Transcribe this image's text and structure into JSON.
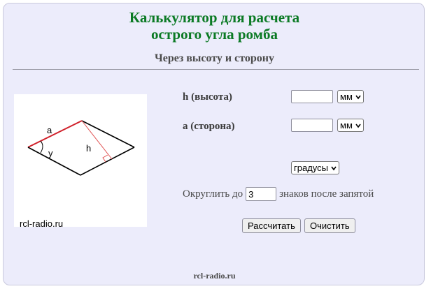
{
  "header": {
    "title_line1": "Калькулятор для расчета",
    "title_line2": "острого угла ромба",
    "subtitle": "Через высоту и сторону"
  },
  "diagram": {
    "label_a": "a",
    "label_h": "h",
    "label_angle": "y",
    "watermark": "rcl-radio.ru"
  },
  "form": {
    "height_label": "h (высота)",
    "height_value": "",
    "height_unit": "мм",
    "side_label": "a (сторона)",
    "side_value": "",
    "side_unit": "мм",
    "angle_unit": "градусы",
    "round_prefix": "Округлить до",
    "round_value": "3",
    "round_suffix": "знаков после запятой",
    "calc_button": "Рассчитать",
    "clear_button": "Очистить"
  },
  "footer": {
    "text": "rcl-radio.ru"
  },
  "colors": {
    "title": "#0b7a24",
    "panel_bg": "#ececfb",
    "highlight_side": "#d0202a",
    "height_line": "#e05050"
  }
}
